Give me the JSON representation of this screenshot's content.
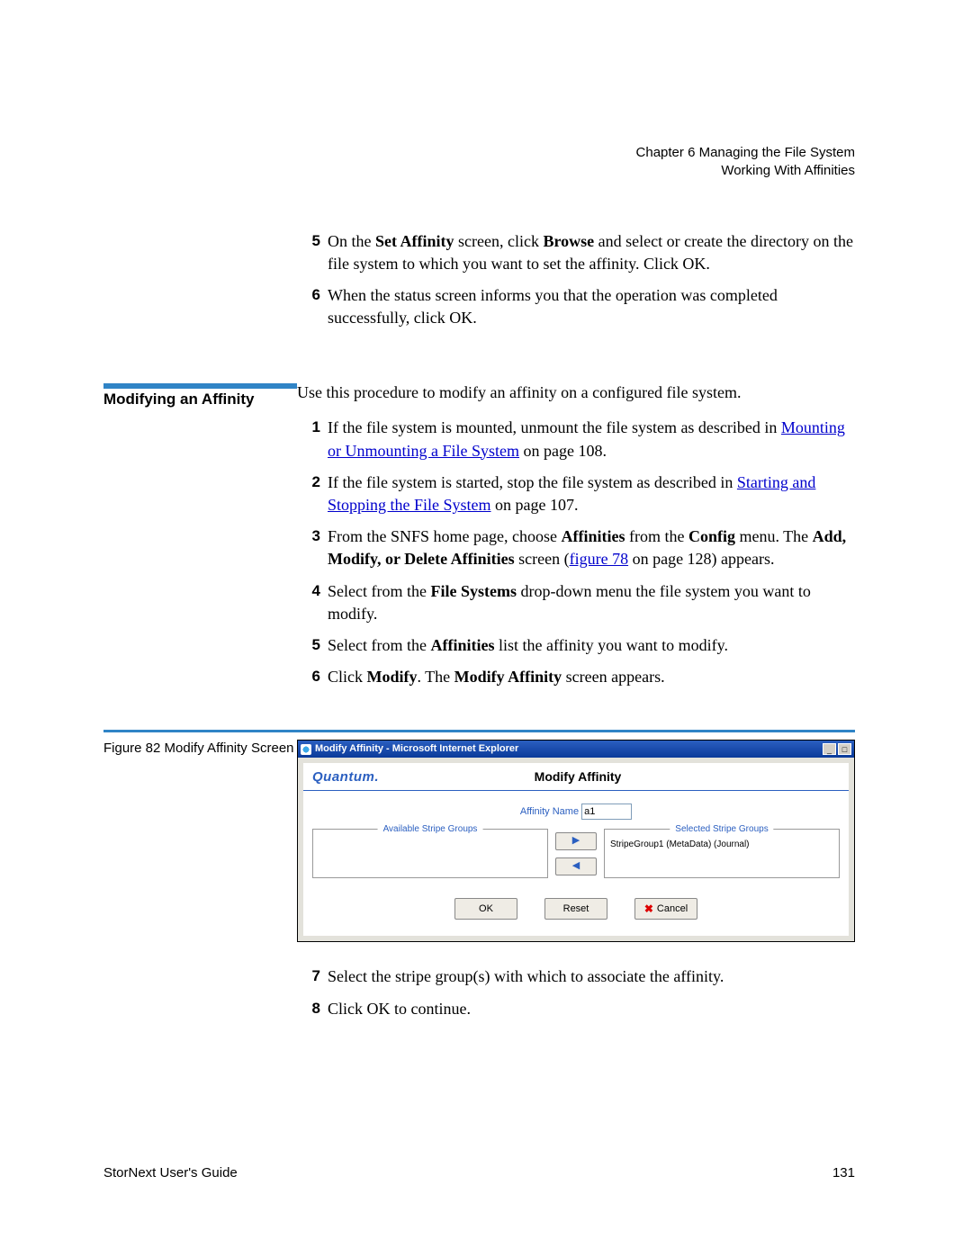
{
  "header": {
    "chapter": "Chapter 6  Managing the File System",
    "section": "Working With Affinities"
  },
  "topList": {
    "items": [
      {
        "num": "5",
        "pre": "On the ",
        "b1": "Set Affinity",
        "mid1": " screen, click ",
        "b2": "Browse",
        "post": " and select or create the directory on the file system to which you want to set the affinity. Click OK."
      },
      {
        "num": "6",
        "text": "When the status screen informs you that the operation was completed successfully, click OK."
      }
    ]
  },
  "heading": "Modifying an Affinity",
  "intro": "Use this procedure to modify an affinity on a configured file system.",
  "steps": {
    "s1": {
      "num": "1",
      "pre": "If the file system is mounted, unmount the file system as described in ",
      "link": "Mounting or Unmounting a File System",
      "post": " on page  108."
    },
    "s2": {
      "num": "2",
      "pre": "If the file system is started, stop the file system as described in ",
      "link": "Starting and Stopping the File System",
      "post": " on page  107."
    },
    "s3": {
      "num": "3",
      "pre": "From the SNFS home page, choose ",
      "b1": "Affinities",
      "mid1": " from the ",
      "b2": "Config",
      "mid2": " menu. The ",
      "b3": "Add, Modify, or Delete Affinities",
      "mid3": " screen (",
      "link": "figure 78",
      "post": " on page 128) appears."
    },
    "s4": {
      "num": "4",
      "pre": "Select from the ",
      "b1": "File Systems",
      "post": " drop-down menu the file system you want to modify."
    },
    "s5": {
      "num": "5",
      "pre": "Select from the ",
      "b1": "Affinities",
      "post": " list the affinity you want to modify."
    },
    "s6": {
      "num": "6",
      "pre": "Click ",
      "b1": "Modify",
      "mid1": ". The ",
      "b2": "Modify Affinity",
      "post": " screen appears."
    }
  },
  "figure": {
    "caption_prefix": "Figure 82",
    "caption_rest": "  Modify Affinity Screen",
    "title": "Modify Affinity - Microsoft Internet Explorer",
    "brand": "Quantum.",
    "panel_title": "Modify Affinity",
    "affinity_label": "Affinity Name",
    "affinity_value": "a1",
    "left_legend": "Available Stripe Groups",
    "right_legend": "Selected Stripe Groups",
    "right_item": "StripeGroup1 (MetaData) (Journal)",
    "ok": "OK",
    "reset": "Reset",
    "cancel": "Cancel"
  },
  "afterFig": {
    "s7": {
      "num": "7",
      "text": "Select the stripe group(s) with which to associate the affinity."
    },
    "s8": {
      "num": "8",
      "text": "Click OK to continue."
    }
  },
  "footer": {
    "left": "StorNext User's Guide",
    "right": "131"
  }
}
